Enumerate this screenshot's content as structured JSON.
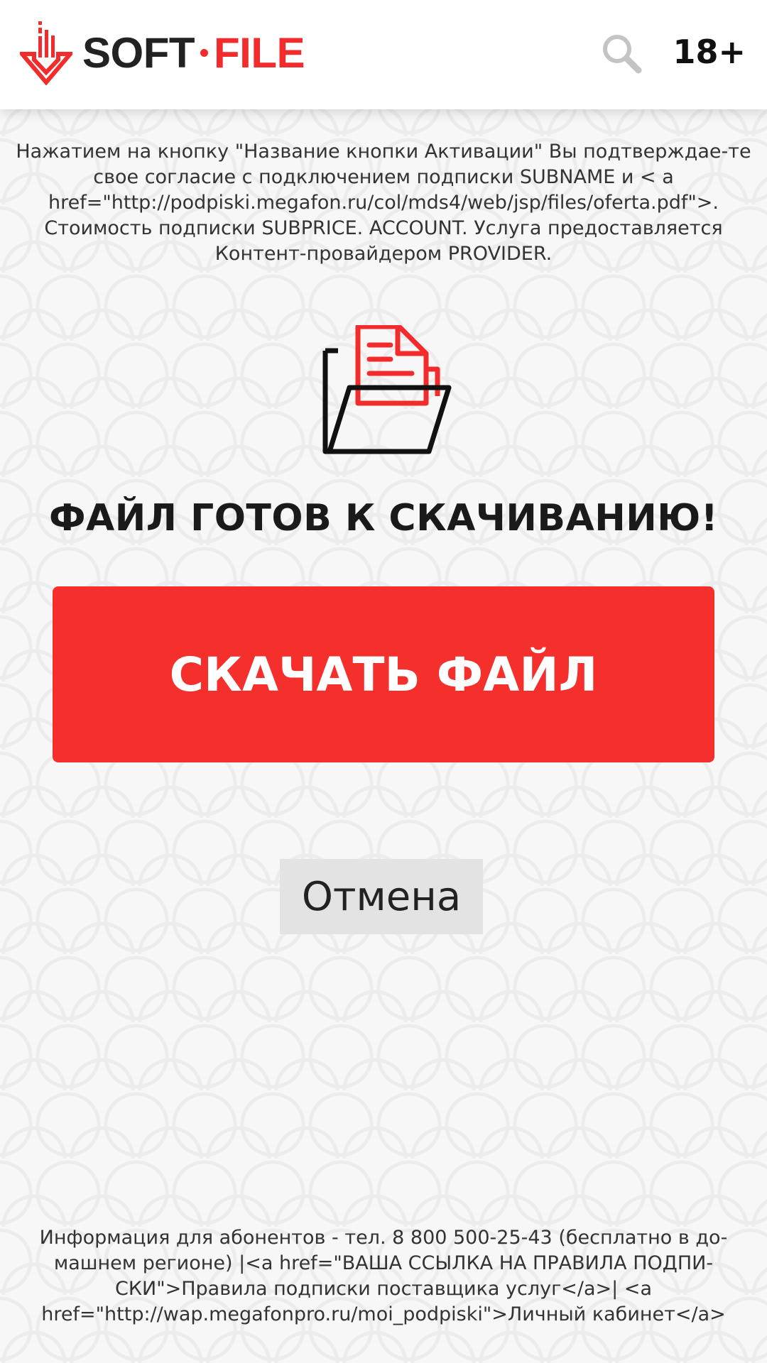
{
  "header": {
    "logo_left": "SOFT",
    "logo_right": "FILE",
    "age_rating": "18+"
  },
  "notice": {
    "text": "Нажатием на кнопку \"Название кнопки Активации\" Вы подтверждае-те свое согласие с подключением подписки SUBNAME и < a href=\"http://podpiski.megafon.ru/col/mds4/web/jsp/files/oferta.pdf\">. Стоимость подписки SUBPRICE. ACCOUNT. Услуга предоставляется Контент-провайдером PROVIDER."
  },
  "main": {
    "title": "ФАЙЛ ГОТОВ К СКАЧИВАНИЮ!",
    "download_label": "СКАЧАТЬ ФАЙЛ",
    "cancel_label": "Отмена"
  },
  "footer": {
    "text": "Информация для абонентов - тел. 8 800 500-25-43 (бесплатно в до-машнем регионе) |<a href=\"ВАША ССЫЛКА НА ПРАВИЛА ПОДПИ-СКИ\">Правила подписки поставщика услуг</a>| <a href=\"http://wap.megafonpro.ru/moi_podpiski\">Личный кабинет</a>"
  },
  "icons": {
    "logo": "download-arrow-icon",
    "search": "search-icon",
    "file": "folder-document-icon"
  },
  "colors": {
    "accent": "#f42f2c",
    "background": "#f7f7f7",
    "cancel_bg": "#e3e3e3"
  }
}
